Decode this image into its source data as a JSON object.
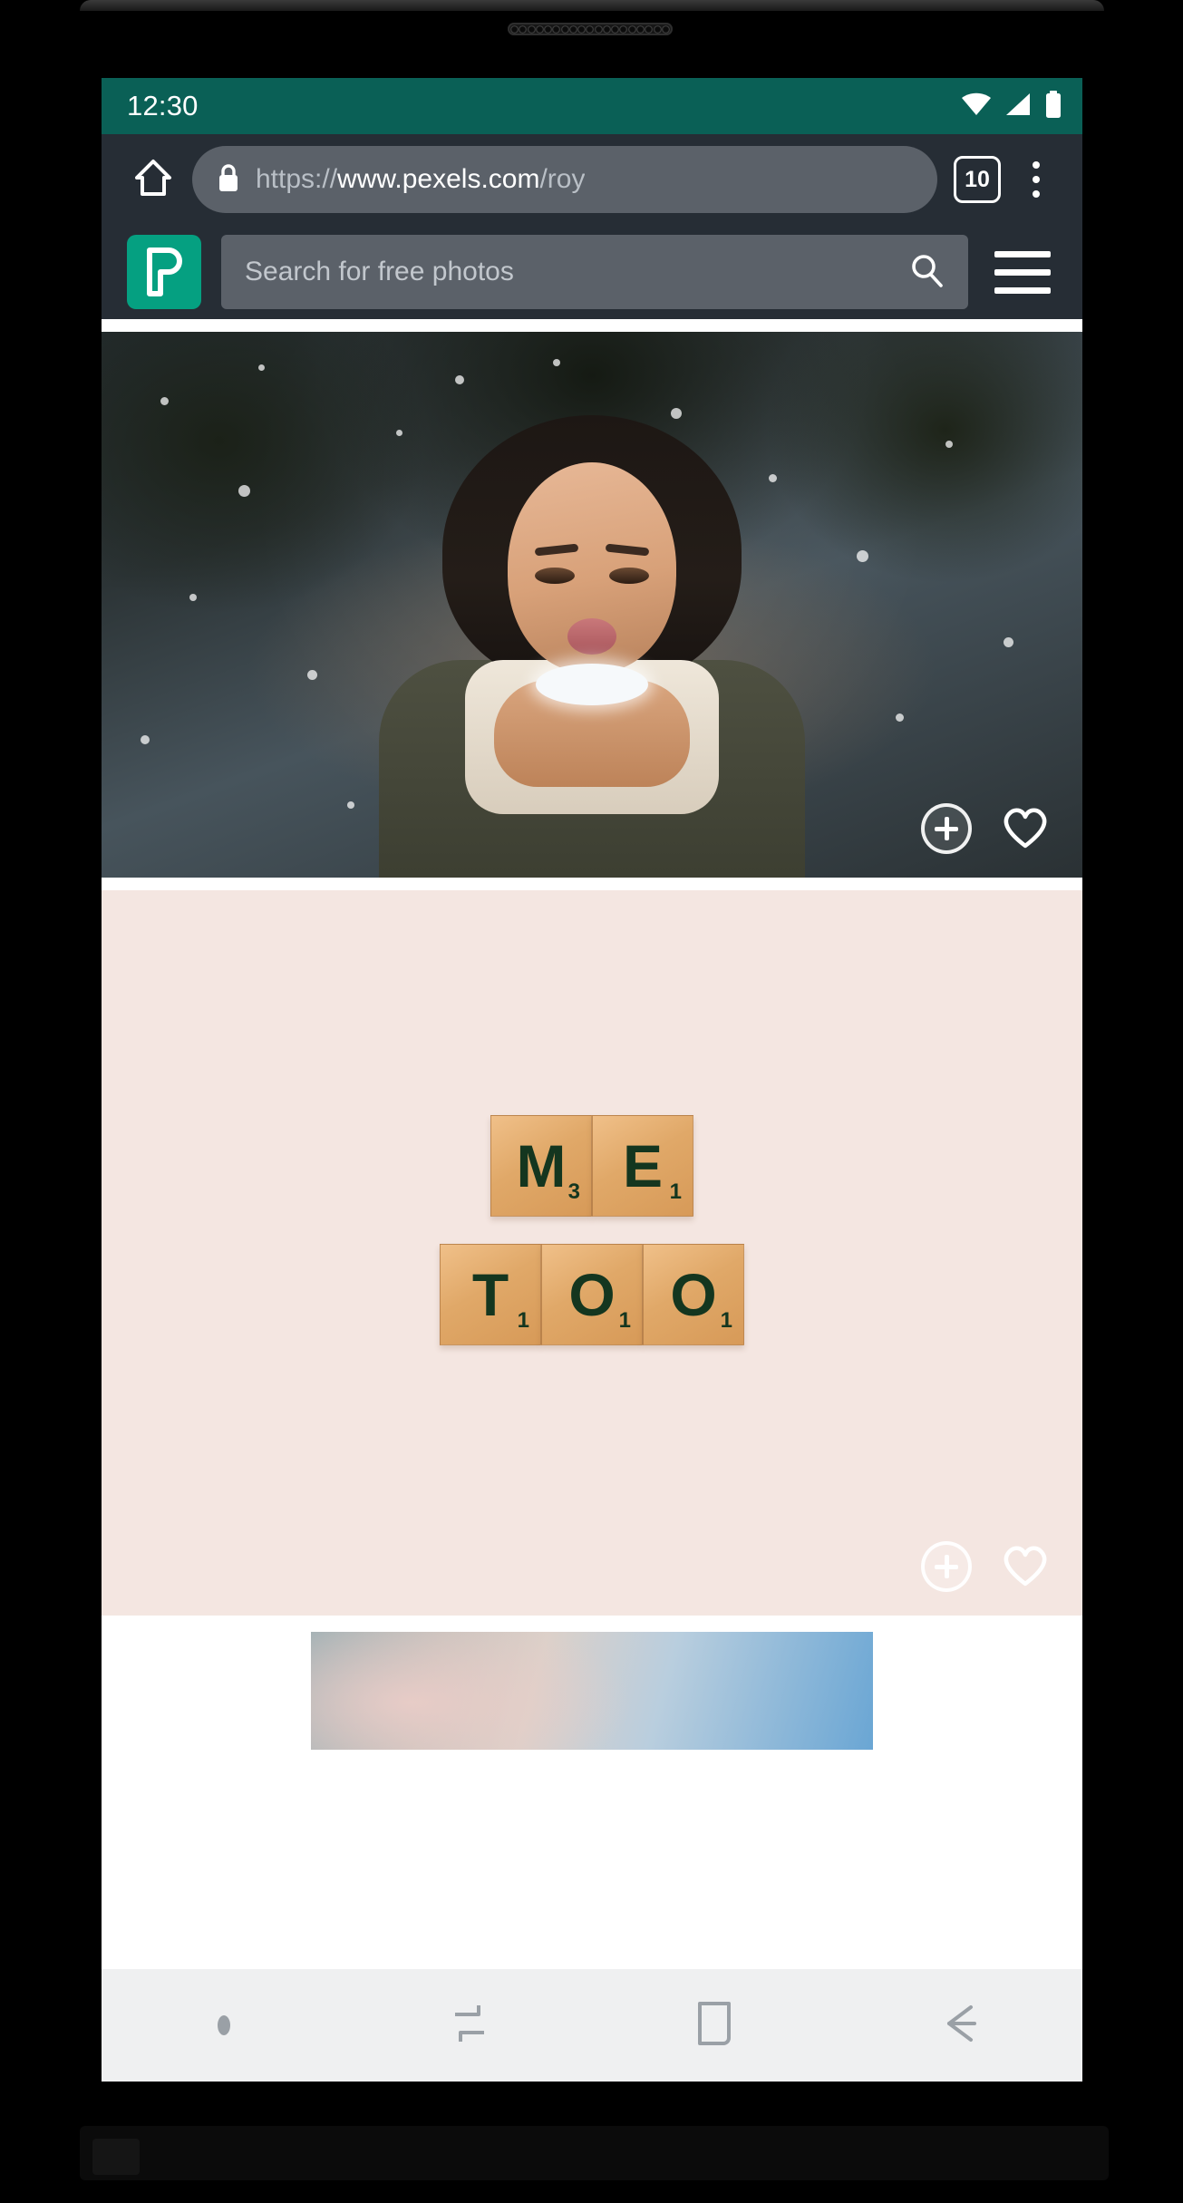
{
  "device": {
    "speaker_grille_holes": 19
  },
  "status_bar": {
    "clock": "12:30",
    "background_color": "#0a6056",
    "icons": [
      "wifi-icon",
      "cell-signal-icon",
      "battery-icon"
    ]
  },
  "browser": {
    "background_color": "#262d35",
    "home_icon": "home-icon",
    "lock_icon": "lock-icon",
    "url": {
      "scheme": "https://",
      "host": "www.pexels.com",
      "path": "/roy"
    },
    "tab_count": "10",
    "overflow_menu_icon": "three-dots-vertical-icon"
  },
  "site_header": {
    "logo_name": "pexels-logo",
    "logo_color": "#05a081",
    "logo_letter": "P",
    "search": {
      "placeholder": "Search for free photos",
      "value": "",
      "icon": "search-icon"
    },
    "hamburger_icon": "hamburger-menu-icon"
  },
  "feed": {
    "photos": [
      {
        "name": "photo-winter-woman-blowing-snow",
        "description": "Woman in olive winter coat and cream scarf blowing snow from her hands",
        "actions": [
          "add-to-collection-plus-icon",
          "like-heart-icon"
        ]
      },
      {
        "name": "photo-scrabble-me-too",
        "description": "Wooden scrabble tiles spelling ME TOO on a pale pink background",
        "tiles_row_1": [
          {
            "letter": "M",
            "points": "3"
          },
          {
            "letter": "E",
            "points": "1"
          }
        ],
        "tiles_row_2": [
          {
            "letter": "T",
            "points": "1"
          },
          {
            "letter": "O",
            "points": "1"
          },
          {
            "letter": "O",
            "points": "1"
          }
        ],
        "actions": [
          "add-to-collection-plus-icon",
          "like-heart-icon"
        ]
      },
      {
        "name": "photo-sky-clouds",
        "description": "Blue sky with wispy clouds, partially visible below the fold"
      }
    ]
  },
  "nav_bar": {
    "background_color": "#eff0f1",
    "items": [
      {
        "name": "nav-assistant-dot",
        "icon": "dot-icon"
      },
      {
        "name": "nav-recents",
        "icon": "recents-icon"
      },
      {
        "name": "nav-home",
        "icon": "home-square-icon"
      },
      {
        "name": "nav-back",
        "icon": "back-arrow-icon"
      }
    ]
  }
}
